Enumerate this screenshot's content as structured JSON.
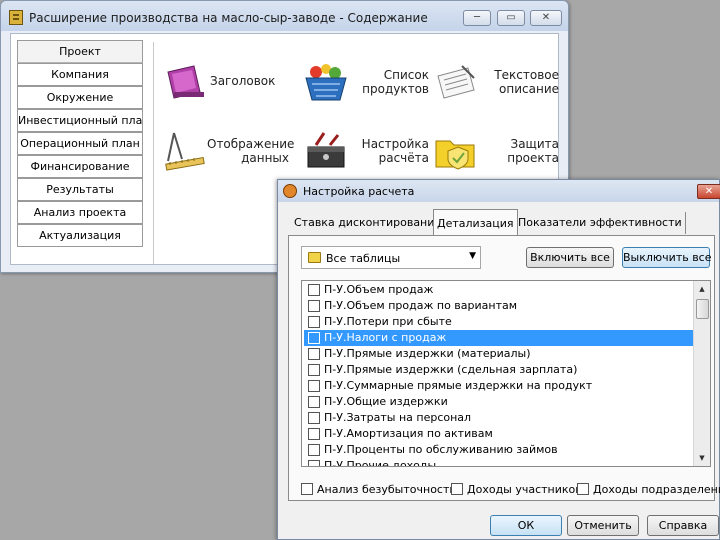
{
  "main_window": {
    "title": "Расширение производства на масло-сыр-заводе - Содержание",
    "caption_buttons": {
      "minimize": "▭",
      "maximize": "▭",
      "close": "✕"
    },
    "nav": [
      "Проект",
      "Компания",
      "Окружение",
      "Инвестиционный план",
      "Операционный план",
      "Финансирование",
      "Результаты",
      "Анализ проекта",
      "Актуализация"
    ],
    "modules": {
      "header": "Заголовок",
      "products": "Список продуктов",
      "text": "Текстовое описание",
      "display": "Отображение данных",
      "calc": "Настройка расчёта",
      "protect": "Защита проекта"
    }
  },
  "dialog": {
    "title": "Настройка расчета",
    "close_glyph": "✕",
    "tabs": [
      "Ставка дисконтирования",
      "Детализация",
      "Показатели эффективности"
    ],
    "active_tab": "Детализация",
    "combo_value": "Все таблицы",
    "combo_arrow": "▼",
    "enable_all": "Включить все",
    "disable_all": "Выключить все",
    "rows": [
      {
        "label": "П-У.Объем продаж",
        "checked": false,
        "selected": false
      },
      {
        "label": "П-У.Объем продаж по вариантам",
        "checked": false,
        "selected": false
      },
      {
        "label": "П-У.Потери при сбыте",
        "checked": false,
        "selected": false
      },
      {
        "label": "П-У.Налоги с продаж",
        "checked": false,
        "selected": true
      },
      {
        "label": "П-У.Прямые издержки (материалы)",
        "checked": false,
        "selected": false
      },
      {
        "label": "П-У.Прямые издержки (сдельная зарплата)",
        "checked": false,
        "selected": false
      },
      {
        "label": "П-У.Суммарные прямые издержки на продукт",
        "checked": false,
        "selected": false
      },
      {
        "label": "П-У.Общие издержки",
        "checked": false,
        "selected": false
      },
      {
        "label": "П-У.Затраты на персонал",
        "checked": false,
        "selected": false
      },
      {
        "label": "П-У.Амортизация по активам",
        "checked": false,
        "selected": false
      },
      {
        "label": "П-У.Проценты по обслуживанию займов",
        "checked": false,
        "selected": false
      },
      {
        "label": "П-У.Прочие доходы",
        "checked": false,
        "selected": false
      }
    ],
    "options": {
      "breakeven": "Анализ безубыточности",
      "participants": "Доходы участников",
      "divisions": "Доходы подразделений"
    },
    "buttons": {
      "ok": "ОК",
      "cancel": "Отменить",
      "help": "Справка"
    },
    "scroll": {
      "up": "▲",
      "down": "▼"
    }
  },
  "colors": {
    "desktop": "#a7a7a7",
    "selection": "#3399ff",
    "dialog_bg": "#f0f0f0",
    "title_bar": "#c9d6ea"
  }
}
